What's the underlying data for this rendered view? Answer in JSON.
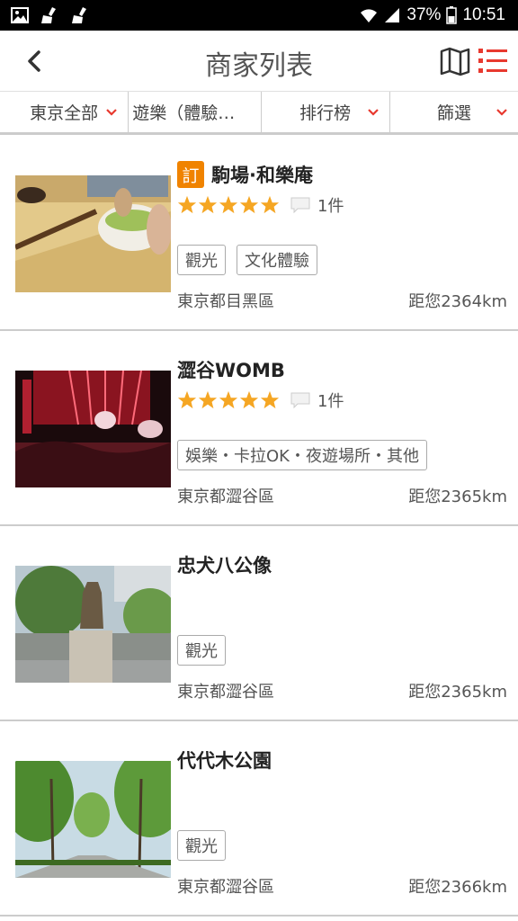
{
  "status_bar": {
    "battery": "37%",
    "time": "10:51"
  },
  "header": {
    "title": "商家列表"
  },
  "filters": [
    {
      "label": "東京全部"
    },
    {
      "label": "遊樂（體驗…"
    },
    {
      "label": "排行榜"
    },
    {
      "label": "篩選"
    }
  ],
  "colors": {
    "accent": "#e8392f",
    "badge": "#f08300",
    "star": "#f5a623"
  },
  "items": [
    {
      "name": "駒場·和樂庵",
      "badge": "訂",
      "rating": 5,
      "comments": "1件",
      "tags": [
        "觀光",
        "文化體驗"
      ],
      "location": "東京都目黑區",
      "distance": "距您2364km"
    },
    {
      "name": "澀谷WOMB",
      "badge": "",
      "rating": 5,
      "comments": "1件",
      "tags": [
        "娛樂・卡拉OK・夜遊場所・其他"
      ],
      "location": "東京都澀谷區",
      "distance": "距您2365km"
    },
    {
      "name": "忠犬八公像",
      "badge": "",
      "rating": 0,
      "comments": "",
      "tags": [
        "觀光"
      ],
      "location": "東京都澀谷區",
      "distance": "距您2365km"
    },
    {
      "name": "代代木公園",
      "badge": "",
      "rating": 0,
      "comments": "",
      "tags": [
        "觀光"
      ],
      "location": "東京都澀谷區",
      "distance": "距您2366km"
    }
  ]
}
